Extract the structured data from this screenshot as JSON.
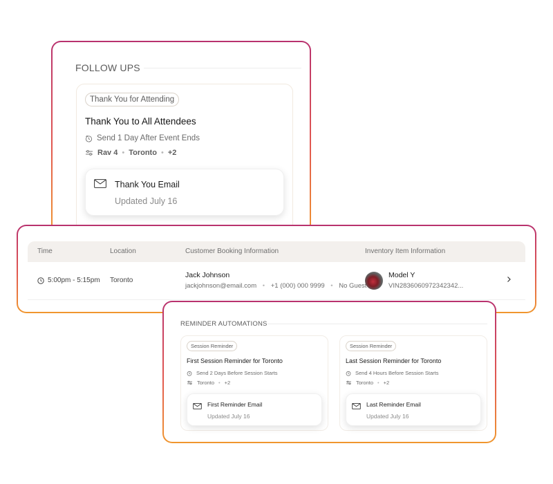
{
  "follow_ups": {
    "section_title": "FOLLOW UPS",
    "chip": "Thank You for Attending",
    "title": "Thank You to All Attendees",
    "schedule": "Send 1 Day After Event Ends",
    "model": "Rav 4",
    "location": "Toronto",
    "more": "+2",
    "email": {
      "title": "Thank You Email",
      "updated": "Updated July 16"
    }
  },
  "booking": {
    "headers": {
      "time": "Time",
      "location": "Location",
      "customer": "Customer Booking Information",
      "inventory": "Inventory Item Information"
    },
    "row": {
      "time": "5:00pm - 5:15pm",
      "location": "Toronto",
      "name": "Jack Johnson",
      "email": "jackjohnson@email.com",
      "phone": "+1 (000) 000 9999",
      "guest": "No Guest",
      "model": "Model Y",
      "vin": "VIN2836060972342342..."
    }
  },
  "reminders": {
    "section_title": "REMINDER AUTOMATIONS",
    "items": [
      {
        "chip": "Session Reminder",
        "title": "First Session Reminder for Toronto",
        "schedule": "Send 2 Days Before Session Starts",
        "location": "Toronto",
        "more": "+2",
        "email_title": "First Reminder Email",
        "updated": "Updated July 16"
      },
      {
        "chip": "Session Reminder",
        "title": "Last Session Reminder for Toronto",
        "schedule": "Send 4 Hours Before Session Starts",
        "location": "Toronto",
        "more": "+2",
        "email_title": "Last Reminder Email",
        "updated": "Updated July 16"
      }
    ]
  },
  "colors": {
    "gradient_top": "#b8316e",
    "gradient_bottom": "#f0962e",
    "table_header_bg": "#f3f0ed"
  },
  "icons": [
    "timer-icon",
    "sliders-icon",
    "envelope-icon",
    "clock-icon",
    "chevron-right-icon"
  ]
}
